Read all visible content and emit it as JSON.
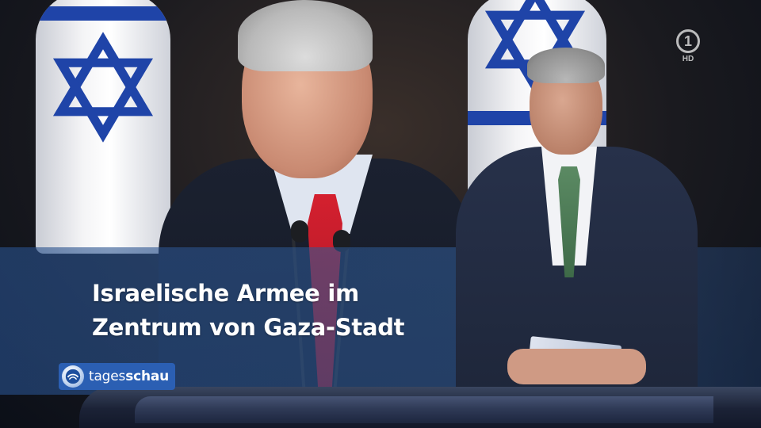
{
  "broadcast": {
    "headline_line1": "Israelische Armee im",
    "headline_line2": "Zentrum von Gaza-Stadt",
    "show_logo_part1": "tages",
    "show_logo_part2": "schau",
    "channel_mark": "1",
    "channel_quality": "HD"
  },
  "colors": {
    "band": "#2f5c98",
    "logo_bg": "#2b5fb3",
    "flag_blue": "#1f44a8",
    "tie_red": "#d4202f",
    "anchor_tie_green": "#4a7a55"
  },
  "icons": {
    "channel_logo": "ard-one-icon",
    "show_emblem": "tagesschau-globe-icon"
  }
}
